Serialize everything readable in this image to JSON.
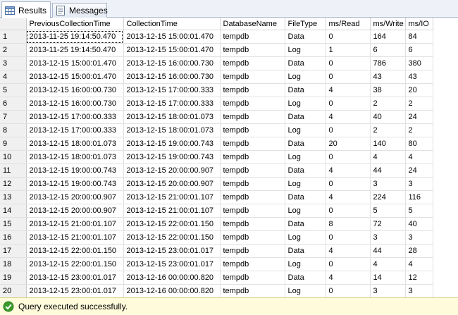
{
  "tabs": [
    {
      "label": "Results",
      "icon": "grid-results-icon",
      "active": true
    },
    {
      "label": "Messages",
      "icon": "messages-icon",
      "active": false
    }
  ],
  "grid": {
    "columns": [
      "PreviousCollectionTime",
      "CollectionTime",
      "DatabaseName",
      "FileType",
      "ms/Read",
      "ms/Write",
      "ms/IO"
    ],
    "rows": [
      [
        "1",
        "2013-11-25 19:14:50.470",
        "2013-12-15 15:00:01.470",
        "tempdb",
        "Data",
        "0",
        "164",
        "84"
      ],
      [
        "2",
        "2013-11-25 19:14:50.470",
        "2013-12-15 15:00:01.470",
        "tempdb",
        "Log",
        "1",
        "6",
        "6"
      ],
      [
        "3",
        "2013-12-15 15:00:01.470",
        "2013-12-15 16:00:00.730",
        "tempdb",
        "Data",
        "0",
        "786",
        "380"
      ],
      [
        "4",
        "2013-12-15 15:00:01.470",
        "2013-12-15 16:00:00.730",
        "tempdb",
        "Log",
        "0",
        "43",
        "43"
      ],
      [
        "5",
        "2013-12-15 16:00:00.730",
        "2013-12-15 17:00:00.333",
        "tempdb",
        "Data",
        "4",
        "38",
        "20"
      ],
      [
        "6",
        "2013-12-15 16:00:00.730",
        "2013-12-15 17:00:00.333",
        "tempdb",
        "Log",
        "0",
        "2",
        "2"
      ],
      [
        "7",
        "2013-12-15 17:00:00.333",
        "2013-12-15 18:00:01.073",
        "tempdb",
        "Data",
        "4",
        "40",
        "24"
      ],
      [
        "8",
        "2013-12-15 17:00:00.333",
        "2013-12-15 18:00:01.073",
        "tempdb",
        "Log",
        "0",
        "2",
        "2"
      ],
      [
        "9",
        "2013-12-15 18:00:01.073",
        "2013-12-15 19:00:00.743",
        "tempdb",
        "Data",
        "20",
        "140",
        "80"
      ],
      [
        "10",
        "2013-12-15 18:00:01.073",
        "2013-12-15 19:00:00.743",
        "tempdb",
        "Log",
        "0",
        "4",
        "4"
      ],
      [
        "11",
        "2013-12-15 19:00:00.743",
        "2013-12-15 20:00:00.907",
        "tempdb",
        "Data",
        "4",
        "44",
        "24"
      ],
      [
        "12",
        "2013-12-15 19:00:00.743",
        "2013-12-15 20:00:00.907",
        "tempdb",
        "Log",
        "0",
        "3",
        "3"
      ],
      [
        "13",
        "2013-12-15 20:00:00.907",
        "2013-12-15 21:00:01.107",
        "tempdb",
        "Data",
        "4",
        "224",
        "116"
      ],
      [
        "14",
        "2013-12-15 20:00:00.907",
        "2013-12-15 21:00:01.107",
        "tempdb",
        "Log",
        "0",
        "5",
        "5"
      ],
      [
        "15",
        "2013-12-15 21:00:01.107",
        "2013-12-15 22:00:01.150",
        "tempdb",
        "Data",
        "8",
        "72",
        "40"
      ],
      [
        "16",
        "2013-12-15 21:00:01.107",
        "2013-12-15 22:00:01.150",
        "tempdb",
        "Log",
        "0",
        "3",
        "3"
      ],
      [
        "17",
        "2013-12-15 22:00:01.150",
        "2013-12-15 23:00:01.017",
        "tempdb",
        "Data",
        "4",
        "44",
        "28"
      ],
      [
        "18",
        "2013-12-15 22:00:01.150",
        "2013-12-15 23:00:01.017",
        "tempdb",
        "Log",
        "0",
        "4",
        "4"
      ],
      [
        "19",
        "2013-12-15 23:00:01.017",
        "2013-12-16 00:00:00.820",
        "tempdb",
        "Data",
        "4",
        "14",
        "12"
      ],
      [
        "20",
        "2013-12-15 23:00:01.017",
        "2013-12-16 00:00:00.820",
        "tempdb",
        "Log",
        "0",
        "3",
        "3"
      ]
    ]
  },
  "status": {
    "message": "Query executed successfully.",
    "icon": "success-check-icon",
    "background": "#fffbdb",
    "icon_color": "#3a9a2a"
  }
}
